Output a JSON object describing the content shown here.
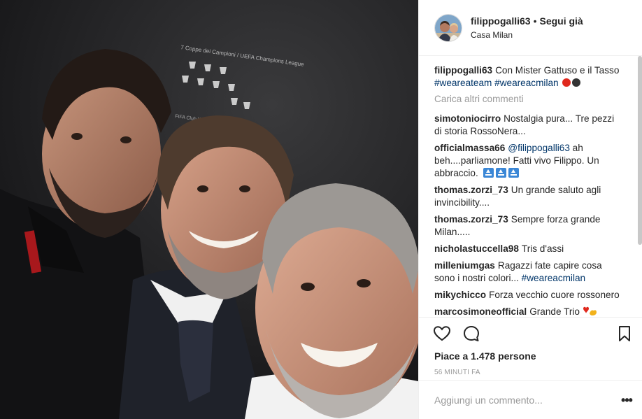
{
  "post": {
    "username": "filippogalli63",
    "separator": "•",
    "follow_label": "Segui già",
    "location": "Casa Milan"
  },
  "caption": {
    "username": "filippogalli63",
    "text": "Con Mister Gattuso e il Tasso",
    "hashtag_1": "#weareateam",
    "hashtag_2": "#weareacmilan"
  },
  "load_more_label": "Carica altri commenti",
  "comments": [
    {
      "user": "simotoniocirro",
      "text": "Nostalgia pura... Tre pezzi di storia RossoNera..."
    },
    {
      "user": "officialmassa66",
      "mention": "@filippogalli63",
      "text": "ah beh....parliamone! Fatti vivo Filippo. Un abbraccio."
    },
    {
      "user": "thomas.zorzi_73",
      "text": "Un grande saluto agli invincibility...."
    },
    {
      "user": "thomas.zorzi_73",
      "text": "Sempre forza grande Milan....."
    },
    {
      "user": "nicholastuccella98",
      "text": "Tris d'assi"
    },
    {
      "user": "milleniumgas",
      "text": "Ragazzi fate capire cosa sono i nostri colori...",
      "hashtag": "#weareacmilan"
    },
    {
      "user": "mikychicco",
      "text": "Forza vecchio cuore rossonero"
    },
    {
      "user": "marcosimoneofficial",
      "text": "Grande Trio"
    }
  ],
  "likes_text": "Piace a 1.478 persone",
  "time_text": "56 MINUTI FA",
  "add_comment_placeholder": "Aggiungi un commento...",
  "more_label": "•••",
  "colors": {
    "red_dot": "#e0281d",
    "black_dot": "#333333",
    "badge_blue": "#3b87d6",
    "hashtag": "#003569"
  },
  "icons": {
    "like": "heart-icon",
    "comment": "comment-bubble-icon",
    "save": "bookmark-icon",
    "more": "more-options-icon"
  }
}
